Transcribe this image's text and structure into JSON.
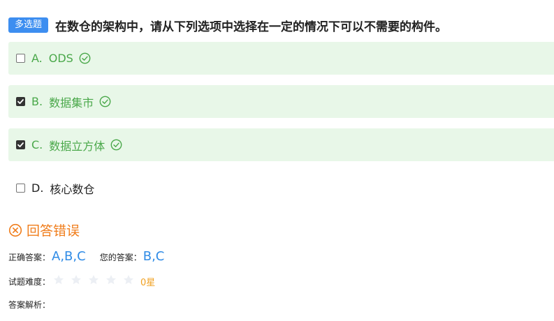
{
  "question": {
    "type_badge": "多选题",
    "text": "在数仓的架构中，请从下列选项中选择在一定的情况下可以不需要的构件。"
  },
  "options": [
    {
      "letter": "A.",
      "text": "ODS",
      "checked": false,
      "correct": true
    },
    {
      "letter": "B.",
      "text": "数据集市",
      "checked": true,
      "correct": true
    },
    {
      "letter": "C.",
      "text": "数据立方体",
      "checked": true,
      "correct": true
    },
    {
      "letter": "D.",
      "text": "核心数仓",
      "checked": false,
      "correct": false
    }
  ],
  "result": {
    "icon": "x-circle-icon",
    "text": "回答错误"
  },
  "answers": {
    "correct_label": "正确答案：",
    "correct_value": "A,B,C",
    "yours_label": "您的答案：",
    "yours_value": "B,C"
  },
  "difficulty": {
    "label": "试题难度：",
    "stars_total": 5,
    "stars_filled": 0,
    "text": "0星"
  },
  "analysis": {
    "label": "答案解析："
  },
  "colors": {
    "badge": "#3d8ef0",
    "correct_bg": "#e8f7e8",
    "correct_text": "#4aa84a",
    "error": "#f07d1b",
    "answer_value": "#2f8be6",
    "star_empty": "#eceff4",
    "difficulty_text": "#f0a020"
  }
}
